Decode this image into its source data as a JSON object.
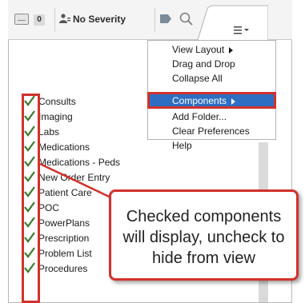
{
  "toolbar": {
    "badge_count": "0",
    "severity_label": "No Severity"
  },
  "menu": {
    "items": [
      {
        "label": "View Layout",
        "has_submenu": true
      },
      {
        "label": "Drag and Drop",
        "has_submenu": false
      },
      {
        "label": "Collapse All",
        "has_submenu": false
      },
      {
        "label": "Components",
        "has_submenu": true,
        "selected": true
      },
      {
        "label": "Add Folder...",
        "has_submenu": false
      },
      {
        "label": "Clear Preferences",
        "has_submenu": false
      },
      {
        "label": "Help",
        "has_submenu": false
      }
    ]
  },
  "components": {
    "items": [
      {
        "label": "Consults",
        "checked": true
      },
      {
        "label": "Imaging",
        "checked": true
      },
      {
        "label": "Labs",
        "checked": true
      },
      {
        "label": "Medications",
        "checked": true
      },
      {
        "label": "Medications - Peds",
        "checked": true
      },
      {
        "label": "New Order Entry",
        "checked": true
      },
      {
        "label": "Patient Care",
        "checked": true
      },
      {
        "label": "POC",
        "checked": true
      },
      {
        "label": "PowerPlans",
        "checked": true
      },
      {
        "label": "Prescription",
        "checked": true
      },
      {
        "label": "Problem List",
        "checked": true
      },
      {
        "label": "Procedures",
        "checked": true
      }
    ]
  },
  "callout": {
    "text": "Checked components will display, uncheck to hide from view"
  },
  "colors": {
    "accent_red": "#d2312c",
    "selected_blue": "#2e6ec2",
    "check_green": "#3a7d2e"
  },
  "icons": [
    "inbox-icon",
    "person-icon",
    "tag-icon",
    "search-icon",
    "hamburger-menu-icon",
    "check-icon",
    "submenu-arrow-icon"
  ]
}
